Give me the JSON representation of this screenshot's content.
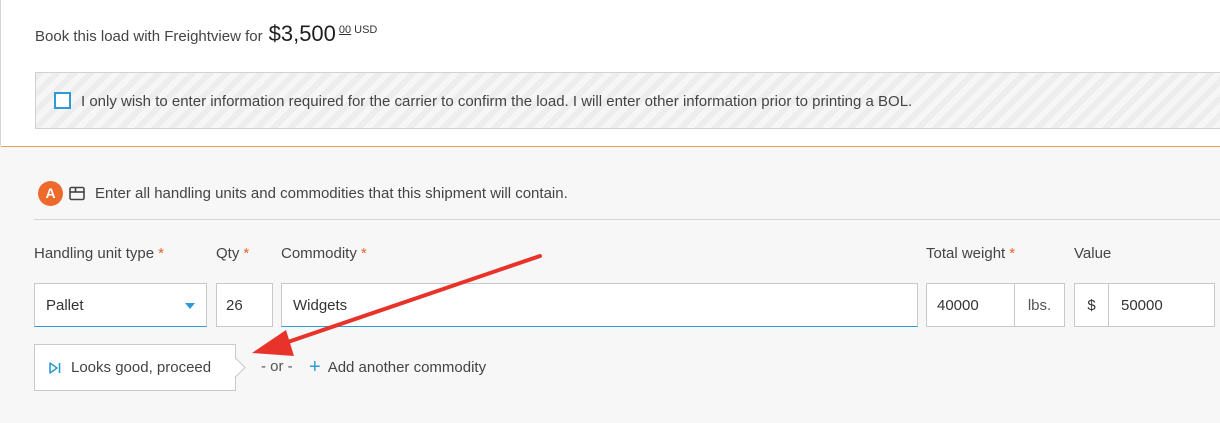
{
  "booking": {
    "prefix_text": "Book this load with Freightview for",
    "price_main": "$3,500",
    "price_cents": "00",
    "currency": "USD"
  },
  "confirm_option": {
    "checked": false,
    "label": "I only wish to enter information required for the carrier to confirm the load. I will enter other information prior to printing a BOL."
  },
  "section": {
    "step_letter": "A",
    "icon": "box-icon",
    "title": "Enter all handling units and commodities that this shipment will contain."
  },
  "fields": {
    "handling_unit_type": {
      "label": "Handling unit type",
      "required_mark": "*",
      "value": "Pallet"
    },
    "qty": {
      "label": "Qty",
      "required_mark": "*",
      "value": "26"
    },
    "commodity": {
      "label": "Commodity",
      "required_mark": "*",
      "value": "Widgets"
    },
    "total_weight": {
      "label": "Total weight",
      "required_mark": "*",
      "value": "40000",
      "unit": "lbs."
    },
    "value": {
      "label": "Value",
      "prefix": "$",
      "value": "50000"
    }
  },
  "actions": {
    "proceed_label": "Looks good, proceed",
    "or_text": "- or -",
    "add_commodity_label": "Add another commodity"
  },
  "colors": {
    "accent_blue": "#2e9bd6",
    "required_orange": "#e8642a",
    "badge_orange": "#ee6a2c",
    "annotation_red": "#e8332a"
  }
}
